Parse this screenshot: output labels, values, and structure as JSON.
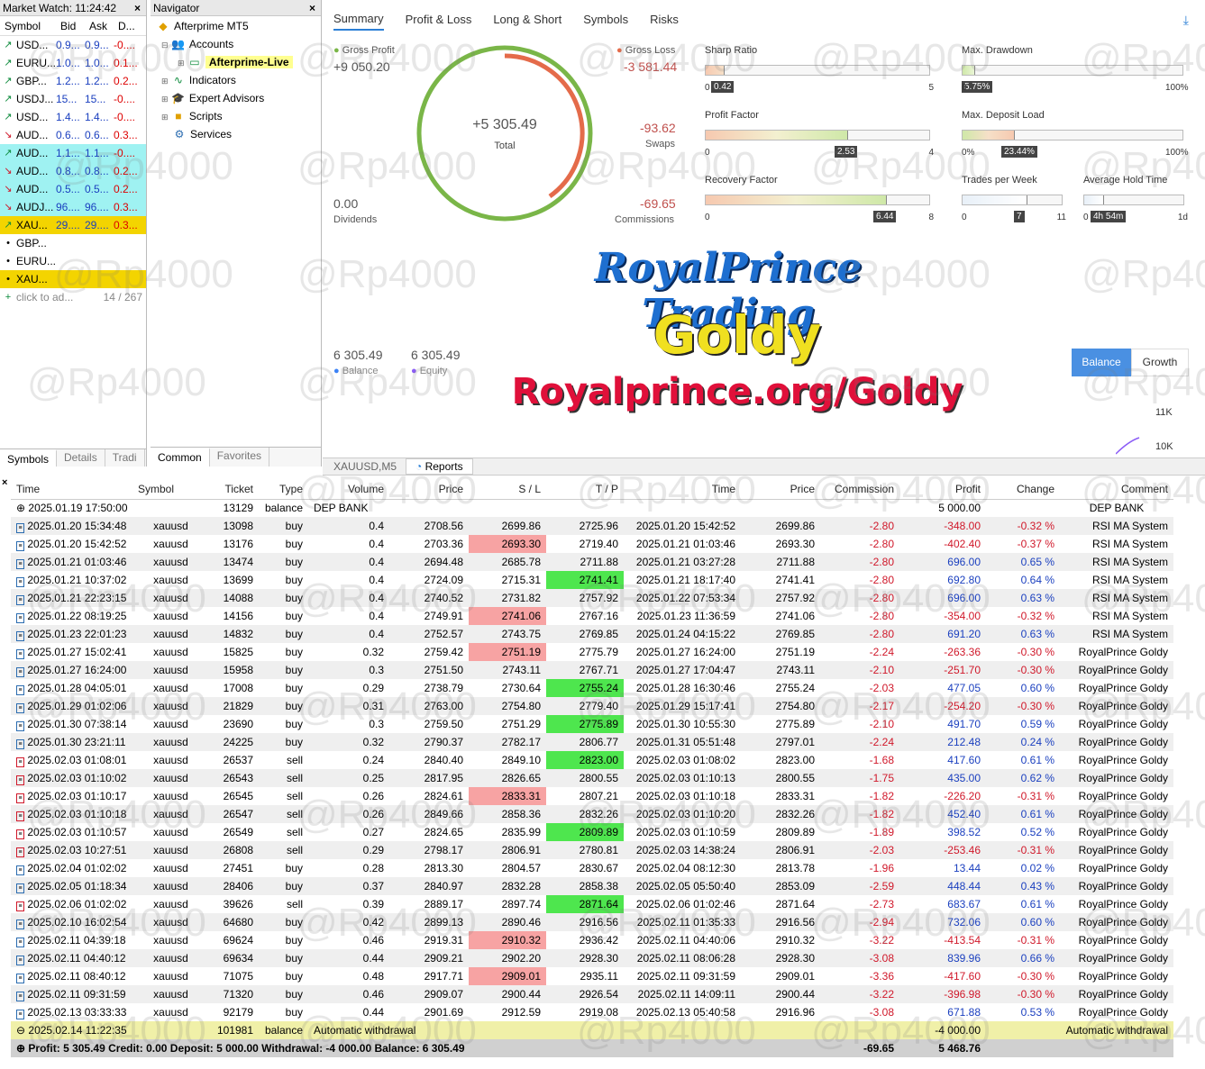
{
  "market_watch": {
    "title": "Market Watch: 11:24:42",
    "headers": [
      "Symbol",
      "Bid",
      "Ask",
      "D..."
    ],
    "rows": [
      {
        "dir": "up",
        "sym": "USD...",
        "bid": "0.9...",
        "ask": "0.9...",
        "d": "-0....",
        "bg": ""
      },
      {
        "dir": "up",
        "sym": "EURU...",
        "bid": "1.0...",
        "ask": "1.0...",
        "d": "0.1...",
        "bg": ""
      },
      {
        "dir": "up",
        "sym": "GBP...",
        "bid": "1.2...",
        "ask": "1.2...",
        "d": "0.2...",
        "bg": ""
      },
      {
        "dir": "up",
        "sym": "USDJ...",
        "bid": "15...",
        "ask": "15...",
        "d": "-0....",
        "bg": ""
      },
      {
        "dir": "up",
        "sym": "USD...",
        "bid": "1.4...",
        "ask": "1.4...",
        "d": "-0....",
        "bg": ""
      },
      {
        "dir": "dn",
        "sym": "AUD...",
        "bid": "0.6...",
        "ask": "0.6...",
        "d": "0.3...",
        "bg": ""
      },
      {
        "dir": "up",
        "sym": "AUD...",
        "bid": "1.1...",
        "ask": "1.1...",
        "d": "-0....",
        "bg": "cyan"
      },
      {
        "dir": "dn",
        "sym": "AUD...",
        "bid": "0.8...",
        "ask": "0.8...",
        "d": "0.2...",
        "bg": "cyan"
      },
      {
        "dir": "dn",
        "sym": "AUD...",
        "bid": "0.5...",
        "ask": "0.5...",
        "d": "0.2...",
        "bg": "cyan"
      },
      {
        "dir": "dn",
        "sym": "AUDJ...",
        "bid": "96....",
        "ask": "96....",
        "d": "0.3...",
        "bg": "cyan"
      },
      {
        "dir": "up",
        "sym": "XAU...",
        "bid": "29....",
        "ask": "29....",
        "d": "0.3...",
        "bg": "gold"
      },
      {
        "dir": "dot",
        "sym": "GBP...",
        "bid": "",
        "ask": "",
        "d": "",
        "bg": ""
      },
      {
        "dir": "dot",
        "sym": "EURU...",
        "bid": "",
        "ask": "",
        "d": "",
        "bg": ""
      },
      {
        "dir": "dot",
        "sym": "XAU...",
        "bid": "",
        "ask": "",
        "d": "",
        "bg": "gold"
      }
    ],
    "add_placeholder": "click to ad...",
    "count": "14 / 267",
    "tabs": [
      "Symbols",
      "Details",
      "Tradi"
    ]
  },
  "navigator": {
    "title": "Navigator",
    "root": "Afterprime MT5",
    "accounts": "Accounts",
    "account_live": "Afterprime-Live",
    "indicators": "Indicators",
    "experts": "Expert Advisors",
    "scripts": "Scripts",
    "services": "Services",
    "tabs": [
      "Common",
      "Favorites"
    ]
  },
  "report": {
    "tabs": [
      "Summary",
      "Profit & Loss",
      "Long & Short",
      "Symbols",
      "Risks"
    ],
    "gross_profit_label": "Gross Profit",
    "gross_profit": "+9 050.20",
    "gross_loss_label": "Gross Loss",
    "gross_loss": "-3 581.44",
    "total": "+5 305.49",
    "total_label": "Total",
    "swaps": "-93.62",
    "swaps_label": "Swaps",
    "dividends": "0.00",
    "dividends_label": "Dividends",
    "commissions": "-69.65",
    "commissions_label": "Commissions",
    "balance": "6 305.49",
    "balance_label": "Balance",
    "equity": "6 305.49",
    "equity_label": "Equity",
    "balance_btn": "Balance",
    "growth_btn": "Growth",
    "y_11k": "11K",
    "y_10k": "10K",
    "metrics": {
      "sharp_ratio": {
        "name": "Sharp Ratio",
        "value": "0.42",
        "min": "0",
        "max": "5",
        "frac": 0.084
      },
      "max_drawdown": {
        "name": "Max. Drawdown",
        "value": "5.75%",
        "min": "0",
        "max": "100%",
        "frac": 0.0575
      },
      "profit_factor": {
        "name": "Profit Factor",
        "value": "2.53",
        "min": "0",
        "max": "4",
        "frac": 0.63
      },
      "max_deposit_load": {
        "name": "Max. Deposit Load",
        "value": "23.44%",
        "min": "0%",
        "max": "100%",
        "frac": 0.2344
      },
      "recovery_factor": {
        "name": "Recovery Factor",
        "value": "6.44",
        "min": "0",
        "max": "8",
        "frac": 0.805
      },
      "trades_per_week": {
        "name": "Trades per Week",
        "value": "7",
        "min": "0",
        "max": "11",
        "frac": 0.64
      },
      "avg_hold": {
        "name": "Average Hold Time",
        "value": "4h 54m",
        "min": "0",
        "max": "1d",
        "frac": 0.2
      }
    }
  },
  "overlay": {
    "brand": "RoyalPrince Trading",
    "product": "Goldy",
    "url": "Royalprince.org/Goldy",
    "watermark": "@Rp4000"
  },
  "strip": {
    "chart_tab": "XAUUSD,M5",
    "reports_tab": "Reports"
  },
  "table": {
    "headers": [
      "Time",
      "Symbol",
      "Ticket",
      "Type",
      "Volume",
      "Price",
      "S / L",
      "T / P",
      "Time",
      "Price",
      "Commission",
      "Profit",
      "Change",
      "Comment"
    ],
    "deposit_row": {
      "time": "2025.01.19 17:50:00",
      "ticket": "13129",
      "type": "balance",
      "volume": "DEP BANK",
      "profit": "5 000.00",
      "comment": "DEP BANK"
    },
    "rows": [
      {
        "t": "2025.01.20 15:34:48",
        "s": "xauusd",
        "k": "13098",
        "ty": "buy",
        "v": "0.4",
        "p": "2708.56",
        "sl": "2699.86",
        "tp": "2725.96",
        "t2": "2025.01.20 15:42:52",
        "p2": "2699.86",
        "c": "-2.80",
        "pr": "-348.00",
        "ch": "-0.32 %",
        "cm": "RSI MA System",
        "hit": "sl"
      },
      {
        "t": "2025.01.20 15:42:52",
        "s": "xauusd",
        "k": "13176",
        "ty": "buy",
        "v": "0.4",
        "p": "2703.36",
        "sl": "2693.30",
        "tp": "2719.40",
        "t2": "2025.01.21 01:03:46",
        "p2": "2693.30",
        "c": "-2.80",
        "pr": "-402.40",
        "ch": "-0.37 %",
        "cm": "RSI MA System",
        "hit": "sl"
      },
      {
        "t": "2025.01.21 01:03:46",
        "s": "xauusd",
        "k": "13474",
        "ty": "buy",
        "v": "0.4",
        "p": "2694.48",
        "sl": "2685.78",
        "tp": "2711.88",
        "t2": "2025.01.21 03:27:28",
        "p2": "2711.88",
        "c": "-2.80",
        "pr": "696.00",
        "ch": "0.65 %",
        "cm": "RSI MA System",
        "hit": "tp"
      },
      {
        "t": "2025.01.21 10:37:02",
        "s": "xauusd",
        "k": "13699",
        "ty": "buy",
        "v": "0.4",
        "p": "2724.09",
        "sl": "2715.31",
        "tp": "2741.41",
        "t2": "2025.01.21 18:17:40",
        "p2": "2741.41",
        "c": "-2.80",
        "pr": "692.80",
        "ch": "0.64 %",
        "cm": "RSI MA System",
        "hit": "tp"
      },
      {
        "t": "2025.01.21 22:23:15",
        "s": "xauusd",
        "k": "14088",
        "ty": "buy",
        "v": "0.4",
        "p": "2740.52",
        "sl": "2731.82",
        "tp": "2757.92",
        "t2": "2025.01.22 07:53:34",
        "p2": "2757.92",
        "c": "-2.80",
        "pr": "696.00",
        "ch": "0.63 %",
        "cm": "RSI MA System",
        "hit": "tp"
      },
      {
        "t": "2025.01.22 08:19:25",
        "s": "xauusd",
        "k": "14156",
        "ty": "buy",
        "v": "0.4",
        "p": "2749.91",
        "sl": "2741.06",
        "tp": "2767.16",
        "t2": "2025.01.23 11:36:59",
        "p2": "2741.06",
        "c": "-2.80",
        "pr": "-354.00",
        "ch": "-0.32 %",
        "cm": "RSI MA System",
        "hit": "sl"
      },
      {
        "t": "2025.01.23 22:01:23",
        "s": "xauusd",
        "k": "14832",
        "ty": "buy",
        "v": "0.4",
        "p": "2752.57",
        "sl": "2743.75",
        "tp": "2769.85",
        "t2": "2025.01.24 04:15:22",
        "p2": "2769.85",
        "c": "-2.80",
        "pr": "691.20",
        "ch": "0.63 %",
        "cm": "RSI MA System",
        "hit": "tp"
      },
      {
        "t": "2025.01.27 15:02:41",
        "s": "xauusd",
        "k": "15825",
        "ty": "buy",
        "v": "0.32",
        "p": "2759.42",
        "sl": "2751.19",
        "tp": "2775.79",
        "t2": "2025.01.27 16:24:00",
        "p2": "2751.19",
        "c": "-2.24",
        "pr": "-263.36",
        "ch": "-0.30 %",
        "cm": "RoyalPrince Goldy",
        "hit": "sl"
      },
      {
        "t": "2025.01.27 16:24:00",
        "s": "xauusd",
        "k": "15958",
        "ty": "buy",
        "v": "0.3",
        "p": "2751.50",
        "sl": "2743.11",
        "tp": "2767.71",
        "t2": "2025.01.27 17:04:47",
        "p2": "2743.11",
        "c": "-2.10",
        "pr": "-251.70",
        "ch": "-0.30 %",
        "cm": "RoyalPrince Goldy",
        "hit": "sl"
      },
      {
        "t": "2025.01.28 04:05:01",
        "s": "xauusd",
        "k": "17008",
        "ty": "buy",
        "v": "0.29",
        "p": "2738.79",
        "sl": "2730.64",
        "tp": "2755.24",
        "t2": "2025.01.28 16:30:46",
        "p2": "2755.24",
        "c": "-2.03",
        "pr": "477.05",
        "ch": "0.60 %",
        "cm": "RoyalPrince Goldy",
        "hit": "tp"
      },
      {
        "t": "2025.01.29 01:02:06",
        "s": "xauusd",
        "k": "21829",
        "ty": "buy",
        "v": "0.31",
        "p": "2763.00",
        "sl": "2754.80",
        "tp": "2779.40",
        "t2": "2025.01.29 15:17:41",
        "p2": "2754.80",
        "c": "-2.17",
        "pr": "-254.20",
        "ch": "-0.30 %",
        "cm": "RoyalPrince Goldy",
        "hit": "sl"
      },
      {
        "t": "2025.01.30 07:38:14",
        "s": "xauusd",
        "k": "23690",
        "ty": "buy",
        "v": "0.3",
        "p": "2759.50",
        "sl": "2751.29",
        "tp": "2775.89",
        "t2": "2025.01.30 10:55:30",
        "p2": "2775.89",
        "c": "-2.10",
        "pr": "491.70",
        "ch": "0.59 %",
        "cm": "RoyalPrince Goldy",
        "hit": "tp"
      },
      {
        "t": "2025.01.30 23:21:11",
        "s": "xauusd",
        "k": "24225",
        "ty": "buy",
        "v": "0.32",
        "p": "2790.37",
        "sl": "2782.17",
        "tp": "2806.77",
        "t2": "2025.01.31 05:51:48",
        "p2": "2797.01",
        "c": "-2.24",
        "pr": "212.48",
        "ch": "0.24 %",
        "cm": "RoyalPrince Goldy",
        "hit": ""
      },
      {
        "t": "2025.02.03 01:08:01",
        "s": "xauusd",
        "k": "26537",
        "ty": "sell",
        "v": "0.24",
        "p": "2840.40",
        "sl": "2849.10",
        "tp": "2823.00",
        "t2": "2025.02.03 01:08:02",
        "p2": "2823.00",
        "c": "-1.68",
        "pr": "417.60",
        "ch": "0.61 %",
        "cm": "RoyalPrince Goldy",
        "hit": "tp"
      },
      {
        "t": "2025.02.03 01:10:02",
        "s": "xauusd",
        "k": "26543",
        "ty": "sell",
        "v": "0.25",
        "p": "2817.95",
        "sl": "2826.65",
        "tp": "2800.55",
        "t2": "2025.02.03 01:10:13",
        "p2": "2800.55",
        "c": "-1.75",
        "pr": "435.00",
        "ch": "0.62 %",
        "cm": "RoyalPrince Goldy",
        "hit": "tp"
      },
      {
        "t": "2025.02.03 01:10:17",
        "s": "xauusd",
        "k": "26545",
        "ty": "sell",
        "v": "0.26",
        "p": "2824.61",
        "sl": "2833.31",
        "tp": "2807.21",
        "t2": "2025.02.03 01:10:18",
        "p2": "2833.31",
        "c": "-1.82",
        "pr": "-226.20",
        "ch": "-0.31 %",
        "cm": "RoyalPrince Goldy",
        "hit": "sl"
      },
      {
        "t": "2025.02.03 01:10:18",
        "s": "xauusd",
        "k": "26547",
        "ty": "sell",
        "v": "0.26",
        "p": "2849.66",
        "sl": "2858.36",
        "tp": "2832.26",
        "t2": "2025.02.03 01:10:20",
        "p2": "2832.26",
        "c": "-1.82",
        "pr": "452.40",
        "ch": "0.61 %",
        "cm": "RoyalPrince Goldy",
        "hit": "tp"
      },
      {
        "t": "2025.02.03 01:10:57",
        "s": "xauusd",
        "k": "26549",
        "ty": "sell",
        "v": "0.27",
        "p": "2824.65",
        "sl": "2835.99",
        "tp": "2809.89",
        "t2": "2025.02.03 01:10:59",
        "p2": "2809.89",
        "c": "-1.89",
        "pr": "398.52",
        "ch": "0.52 %",
        "cm": "RoyalPrince Goldy",
        "hit": "tp"
      },
      {
        "t": "2025.02.03 10:27:51",
        "s": "xauusd",
        "k": "26808",
        "ty": "sell",
        "v": "0.29",
        "p": "2798.17",
        "sl": "2806.91",
        "tp": "2780.81",
        "t2": "2025.02.03 14:38:24",
        "p2": "2806.91",
        "c": "-2.03",
        "pr": "-253.46",
        "ch": "-0.31 %",
        "cm": "RoyalPrince Goldy",
        "hit": "sl"
      },
      {
        "t": "2025.02.04 01:02:02",
        "s": "xauusd",
        "k": "27451",
        "ty": "buy",
        "v": "0.28",
        "p": "2813.30",
        "sl": "2804.57",
        "tp": "2830.67",
        "t2": "2025.02.04 08:12:30",
        "p2": "2813.78",
        "c": "-1.96",
        "pr": "13.44",
        "ch": "0.02 %",
        "cm": "RoyalPrince Goldy",
        "hit": ""
      },
      {
        "t": "2025.02.05 01:18:34",
        "s": "xauusd",
        "k": "28406",
        "ty": "buy",
        "v": "0.37",
        "p": "2840.97",
        "sl": "2832.28",
        "tp": "2858.38",
        "t2": "2025.02.05 05:50:40",
        "p2": "2853.09",
        "c": "-2.59",
        "pr": "448.44",
        "ch": "0.43 %",
        "cm": "RoyalPrince Goldy",
        "hit": ""
      },
      {
        "t": "2025.02.06 01:02:02",
        "s": "xauusd",
        "k": "39626",
        "ty": "sell",
        "v": "0.39",
        "p": "2889.17",
        "sl": "2897.74",
        "tp": "2871.64",
        "t2": "2025.02.06 01:02:46",
        "p2": "2871.64",
        "c": "-2.73",
        "pr": "683.67",
        "ch": "0.61 %",
        "cm": "RoyalPrince Goldy",
        "hit": "tp"
      },
      {
        "t": "2025.02.10 16:02:54",
        "s": "xauusd",
        "k": "64680",
        "ty": "buy",
        "v": "0.42",
        "p": "2899.13",
        "sl": "2890.46",
        "tp": "2916.56",
        "t2": "2025.02.11 01:35:33",
        "p2": "2916.56",
        "c": "-2.94",
        "pr": "732.06",
        "ch": "0.60 %",
        "cm": "RoyalPrince Goldy",
        "hit": "tp"
      },
      {
        "t": "2025.02.11 04:39:18",
        "s": "xauusd",
        "k": "69624",
        "ty": "buy",
        "v": "0.46",
        "p": "2919.31",
        "sl": "2910.32",
        "tp": "2936.42",
        "t2": "2025.02.11 04:40:06",
        "p2": "2910.32",
        "c": "-3.22",
        "pr": "-413.54",
        "ch": "-0.31 %",
        "cm": "RoyalPrince Goldy",
        "hit": "sl"
      },
      {
        "t": "2025.02.11 04:40:12",
        "s": "xauusd",
        "k": "69634",
        "ty": "buy",
        "v": "0.44",
        "p": "2909.21",
        "sl": "2902.20",
        "tp": "2928.30",
        "t2": "2025.02.11 08:06:28",
        "p2": "2928.30",
        "c": "-3.08",
        "pr": "839.96",
        "ch": "0.66 %",
        "cm": "RoyalPrince Goldy",
        "hit": "tp"
      },
      {
        "t": "2025.02.11 08:40:12",
        "s": "xauusd",
        "k": "71075",
        "ty": "buy",
        "v": "0.48",
        "p": "2917.71",
        "sl": "2909.01",
        "tp": "2935.11",
        "t2": "2025.02.11 09:31:59",
        "p2": "2909.01",
        "c": "-3.36",
        "pr": "-417.60",
        "ch": "-0.30 %",
        "cm": "RoyalPrince Goldy",
        "hit": "sl"
      },
      {
        "t": "2025.02.11 09:31:59",
        "s": "xauusd",
        "k": "71320",
        "ty": "buy",
        "v": "0.46",
        "p": "2909.07",
        "sl": "2900.44",
        "tp": "2926.54",
        "t2": "2025.02.11 14:09:11",
        "p2": "2900.44",
        "c": "-3.22",
        "pr": "-396.98",
        "ch": "-0.30 %",
        "cm": "RoyalPrince Goldy",
        "hit": "sl"
      },
      {
        "t": "2025.02.13 03:33:33",
        "s": "xauusd",
        "k": "92179",
        "ty": "buy",
        "v": "0.44",
        "p": "2901.69",
        "sl": "2912.59",
        "tp": "2919.08",
        "t2": "2025.02.13 05:40:58",
        "p2": "2916.96",
        "c": "-3.08",
        "pr": "671.88",
        "ch": "0.53 %",
        "cm": "RoyalPrince Goldy",
        "hit": ""
      }
    ],
    "withdraw_row": {
      "time": "2025.02.14 11:22:35",
      "ticket": "101981",
      "type": "balance",
      "volume": "Automatic withdrawal",
      "profit": "-4 000.00",
      "comment": "Automatic withdrawal"
    },
    "total_row": {
      "summary": "Profit: 5 305.49  Credit: 0.00  Deposit: 5 000.00  Withdrawal: -4 000.00  Balance: 6 305.49",
      "commission": "-69.65",
      "profit": "5 468.76"
    }
  }
}
